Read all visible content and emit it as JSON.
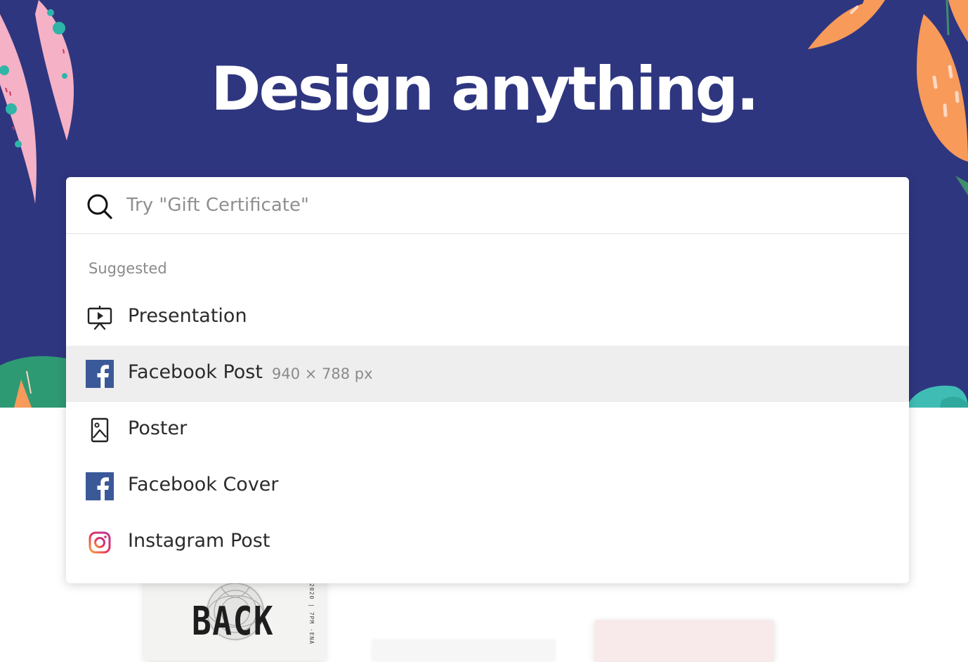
{
  "hero": {
    "headline": "Design anything."
  },
  "search": {
    "placeholder": "Try \"Gift Certificate\"",
    "value": "",
    "icon": "search-icon"
  },
  "suggestions": {
    "label": "Suggested",
    "items": [
      {
        "label": "Presentation",
        "icon": "presentation-icon",
        "dims": ""
      },
      {
        "label": "Facebook Post",
        "icon": "facebook-icon",
        "dims": "940 × 788 px"
      },
      {
        "label": "Poster",
        "icon": "poster-icon",
        "dims": ""
      },
      {
        "label": "Facebook Cover",
        "icon": "facebook-icon",
        "dims": ""
      },
      {
        "label": "Instagram Post",
        "icon": "instagram-icon",
        "dims": ""
      }
    ]
  },
  "background_cards": {
    "back_card_word": "BACK",
    "back_card_vertical_text": "2020 | 7PM  ·ENA"
  },
  "colors": {
    "hero_background": "#2f3680",
    "highlight_row": "#eeeeee",
    "facebook_blue": "#3b5998"
  }
}
